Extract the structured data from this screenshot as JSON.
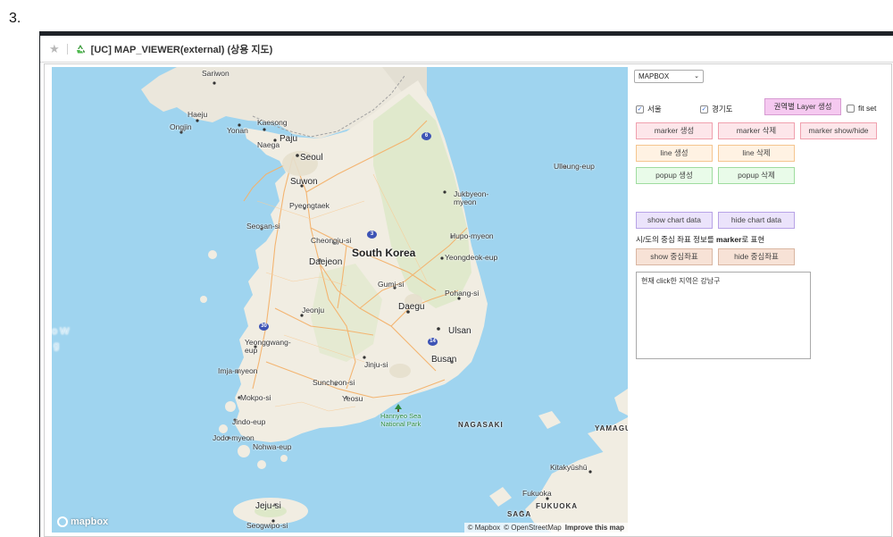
{
  "step": "3.",
  "window": {
    "title": "[UC] MAP_VIEWER(external) (상용 지도)",
    "icons": {
      "favorite": "star-icon",
      "app": "recycle-icon"
    }
  },
  "map": {
    "provider_logo": "mapbox",
    "attribution": [
      "© Mapbox",
      "© OpenStreetMap",
      "Improve this map"
    ],
    "labels": {
      "country": "South Korea",
      "seoul": "Seoul",
      "sariwon": "Sariwon",
      "haeju": "Haeju",
      "ongjin": "Ongjin",
      "yonan": "Yonan",
      "kaesong": "Kaesong",
      "naega": "Naega",
      "paju": "Paju",
      "suwon": "Suwon",
      "pyeongtaek": "Pyeongtaek",
      "seosan": "Seosan-si",
      "cheongju": "Cheongju-si",
      "daejeon": "Daejeon",
      "gumi": "Gumi-si",
      "daegu": "Daegu",
      "pohang": "Pohang-si",
      "jeonju": "Jeonju",
      "ulsan": "Ulsan",
      "busan": "Busan",
      "jinju": "Jinju-si",
      "yeonggwang": "Yeonggwang-\neup",
      "imja": "Imja-myeon",
      "suncheon": "Suncheon-si",
      "yeosu": "Yeosu",
      "mokpo": "Mokpo-si",
      "jindo": "Jindo-eup",
      "jodo": "Jodo-myeon",
      "nohwa": "Nohwa-eup",
      "jeju": "Jeju-si",
      "seogwipo": "Seogwipo-si",
      "uljin": "Ulleung-eup",
      "jukbyeon": "Jukbyeon-\nmyeon",
      "hupo": "Hupo-myeon",
      "yeongdeok": "Yeongdeok-eup",
      "hallyeo": "Hannyeo Sea\nNational Park",
      "nagasaki": "NAGASAKI",
      "yamaguchi": "YAMAGU",
      "kitakyushu": "Kitakyūshū",
      "fukuoka": "Fukuoka",
      "fukuoka_caps": "FUKUOKA",
      "saga": "SAGA",
      "edge_w": "o W",
      "edge_g": "g"
    },
    "shields": [
      "6",
      "3",
      "30",
      "14"
    ]
  },
  "controls": {
    "provider_select": {
      "value": "MAPBOX"
    },
    "checkboxes": [
      {
        "label": "서울",
        "checked": true
      },
      {
        "label": "경기도",
        "checked": true
      },
      {
        "label": "fit set",
        "checked": false
      }
    ],
    "layer_button": "권역별 Layer 생성",
    "buttons": {
      "marker_create": "marker 생성",
      "marker_delete": "marker 삭제",
      "marker_toggle": "marker show/hide",
      "line_create": "line 생성",
      "line_delete": "line 삭제",
      "popup_create": "popup 생성",
      "popup_delete": "popup 삭제",
      "show_chart": "show chart data",
      "hide_chart": "hide chart data",
      "show_center": "show 중심좌표",
      "hide_center": "hide 중심좌표"
    },
    "center_desc_prefix": "시/도의 중심 좌표 정보를 ",
    "center_desc_bold": "marker",
    "center_desc_suffix": "로 표현",
    "output_text": "현재 click한 지역은 강남구"
  },
  "colors": {
    "sea": "#9fd4ef",
    "land": "#f1ede2",
    "mountains": "#dde8c8",
    "roads": "#f4b26b",
    "accent_blue": "#3d53b5"
  }
}
